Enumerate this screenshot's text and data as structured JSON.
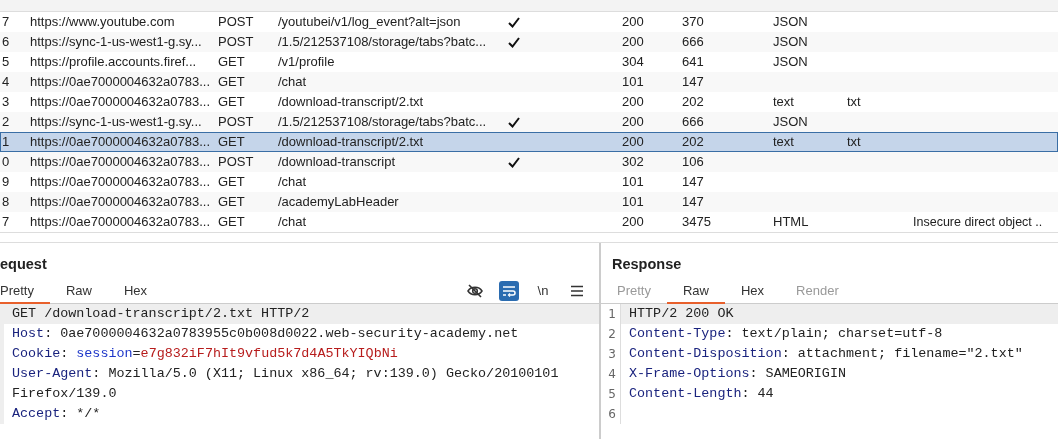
{
  "history": {
    "rows": [
      {
        "number": "7",
        "host": "https://www.youtube.com",
        "method": "POST",
        "url": "/youtubei/v1/log_event?alt=json",
        "params": true,
        "status": "200",
        "length": "370",
        "mime": "JSON",
        "selected": false
      },
      {
        "number": "6",
        "host": "https://sync-1-us-west1-g.sy...",
        "method": "POST",
        "url": "/1.5/212537108/storage/tabs?batc...",
        "params": true,
        "status": "200",
        "length": "666",
        "mime": "JSON",
        "selected": false
      },
      {
        "number": "5",
        "host": "https://profile.accounts.firef...",
        "method": "GET",
        "url": "/v1/profile",
        "params": false,
        "status": "304",
        "length": "641",
        "mime": "JSON",
        "selected": false
      },
      {
        "number": "4",
        "host": "https://0ae7000004632a0783...",
        "method": "GET",
        "url": "/chat",
        "params": false,
        "status": "101",
        "length": "147",
        "selected": false
      },
      {
        "number": "3",
        "host": "https://0ae7000004632a0783...",
        "method": "GET",
        "url": "/download-transcript/2.txt",
        "params": false,
        "status": "200",
        "length": "202",
        "mime": "text",
        "extension": "txt",
        "selected": false
      },
      {
        "number": "2",
        "host": "https://sync-1-us-west1-g.sy...",
        "method": "POST",
        "url": "/1.5/212537108/storage/tabs?batc...",
        "params": true,
        "status": "200",
        "length": "666",
        "mime": "JSON",
        "selected": false
      },
      {
        "number": "1",
        "host": "https://0ae7000004632a0783...",
        "method": "GET",
        "url": "/download-transcript/2.txt",
        "params": false,
        "status": "200",
        "length": "202",
        "mime": "text",
        "extension": "txt",
        "selected": true
      },
      {
        "number": "0",
        "host": "https://0ae7000004632a0783...",
        "method": "POST",
        "url": "/download-transcript",
        "params": true,
        "status": "302",
        "length": "106",
        "selected": false
      },
      {
        "number": "9",
        "host": "https://0ae7000004632a0783...",
        "method": "GET",
        "url": "/chat",
        "params": false,
        "status": "101",
        "length": "147",
        "selected": false
      },
      {
        "number": "8",
        "host": "https://0ae7000004632a0783...",
        "method": "GET",
        "url": "/academyLabHeader",
        "params": false,
        "status": "101",
        "length": "147",
        "selected": false
      },
      {
        "number": "7",
        "host": "https://0ae7000004632a0783...",
        "method": "GET",
        "url": "/chat",
        "params": false,
        "status": "200",
        "length": "3475",
        "mime": "HTML",
        "title": "Insecure direct object ..",
        "selected": false
      }
    ]
  },
  "request": {
    "title": "equest",
    "tabs": [
      {
        "label": "Pretty",
        "selected": true
      },
      {
        "label": "Raw",
        "selected": false
      },
      {
        "label": "Hex",
        "selected": false
      }
    ],
    "toolbar": [
      {
        "kind": "hide",
        "on": false
      },
      {
        "kind": "wrap",
        "on": true
      },
      {
        "kind": "newline",
        "label": "\\n",
        "on": false
      },
      {
        "kind": "menu"
      }
    ],
    "lines": [
      {
        "kind": "start",
        "text": "GET /download-transcript/2.txt HTTP/2"
      },
      {
        "kind": "header",
        "name": "Host",
        "separator": ": ",
        "value": "0ae7000004632a0783955c0b008d0022.web-security-academy.net"
      },
      {
        "kind": "cookie",
        "name": "Cookie",
        "separator": ": ",
        "cookie_name": "session",
        "assign": "=",
        "cookie_value": "e7g832iF7hIt9vfud5k7d4A5TkYIQbNi"
      },
      {
        "kind": "header",
        "name": "User-Agent",
        "separator": ": ",
        "value": "Mozilla/5.0 (X11; Linux x86_64; rv:139.0) Gecko/20100101 Firefox/139.0"
      },
      {
        "kind": "header",
        "name": "Accept",
        "separator": ": ",
        "value": "*/*"
      }
    ]
  },
  "response": {
    "title": "Response",
    "tabs": [
      {
        "label": "Pretty",
        "selected": false,
        "disabled": true
      },
      {
        "label": "Raw",
        "selected": true,
        "disabled": false
      },
      {
        "label": "Hex",
        "selected": false,
        "disabled": false
      },
      {
        "label": "Render",
        "selected": false,
        "disabled": true
      }
    ],
    "lines": [
      {
        "number": "1",
        "kind": "start",
        "text": "HTTP/2 200 OK"
      },
      {
        "number": "2",
        "kind": "header",
        "name": "Content-Type",
        "separator": ": ",
        "value": "text/plain; charset=utf-8"
      },
      {
        "number": "3",
        "kind": "header",
        "name": "Content-Disposition",
        "separator": ": ",
        "value": "attachment; filename=\"2.txt\""
      },
      {
        "number": "4",
        "kind": "header",
        "name": "X-Frame-Options",
        "separator": ": ",
        "value": "SAMEORIGIN"
      },
      {
        "number": "5",
        "kind": "header",
        "name": "Content-Length",
        "separator": ": ",
        "value": "44"
      },
      {
        "number": "6",
        "kind": "blank"
      }
    ]
  }
}
